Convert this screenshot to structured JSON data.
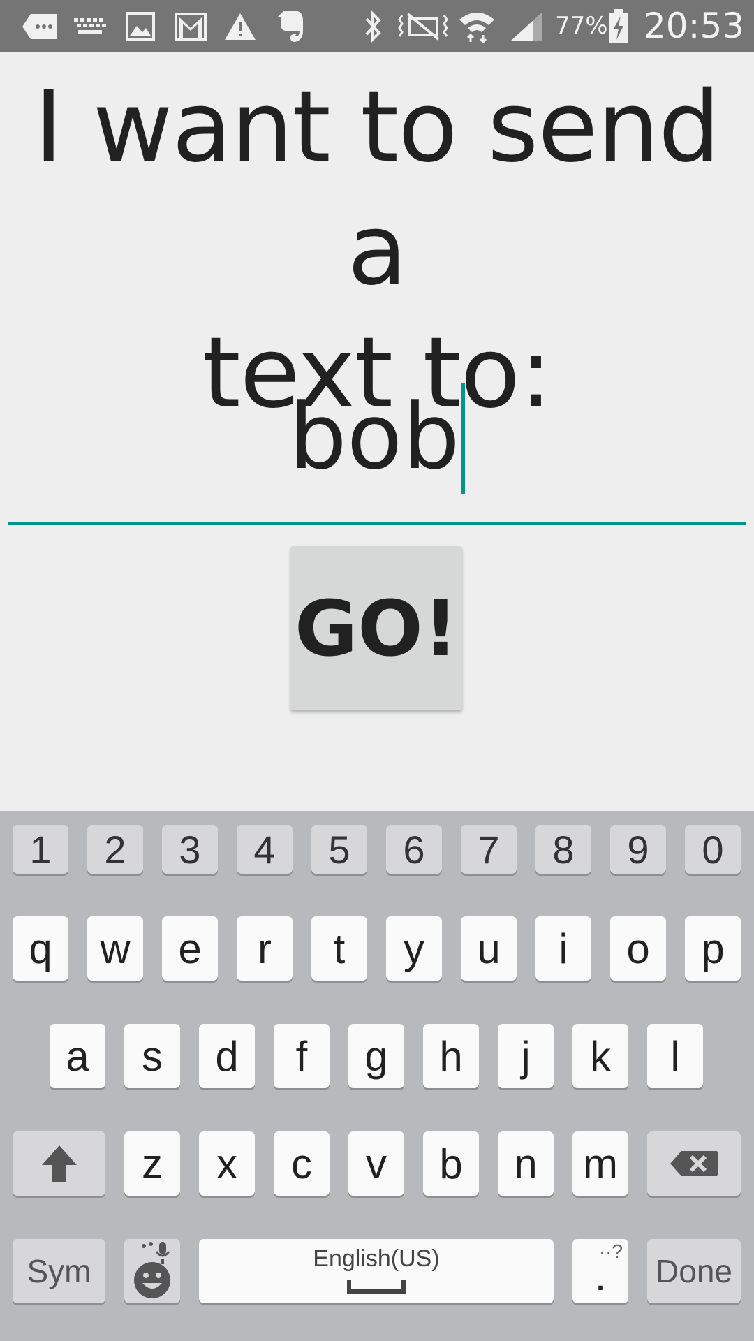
{
  "status_bar": {
    "left_icons": [
      "message-icon",
      "keyboard-icon",
      "image-icon",
      "gmail-icon",
      "warning-icon",
      "evernote-icon"
    ],
    "right_icons": [
      "bluetooth-icon",
      "vibrate-mute-icon",
      "wifi-icon",
      "signal-icon",
      "battery-charging-icon"
    ],
    "battery_percent": "77%",
    "time": "20:53"
  },
  "main": {
    "prompt_line1": "I want to send a",
    "prompt_line2": "text to:",
    "recipient_value": "bob",
    "go_label": "GO!"
  },
  "keyboard": {
    "number_row": [
      "1",
      "2",
      "3",
      "4",
      "5",
      "6",
      "7",
      "8",
      "9",
      "0"
    ],
    "row1": [
      "q",
      "w",
      "e",
      "r",
      "t",
      "y",
      "u",
      "i",
      "o",
      "p"
    ],
    "row2": [
      "a",
      "s",
      "d",
      "f",
      "g",
      "h",
      "j",
      "k",
      "l"
    ],
    "row3": [
      "z",
      "x",
      "c",
      "v",
      "b",
      "n",
      "m"
    ],
    "sym_label": "Sym",
    "space_label": "English(US)",
    "period_label": ".",
    "period_hint": "··?",
    "done_label": "Done"
  },
  "colors": {
    "accent": "#009688",
    "status_bar": "#757575",
    "background": "#eeeeee",
    "keyboard": "#b8b9bd"
  }
}
